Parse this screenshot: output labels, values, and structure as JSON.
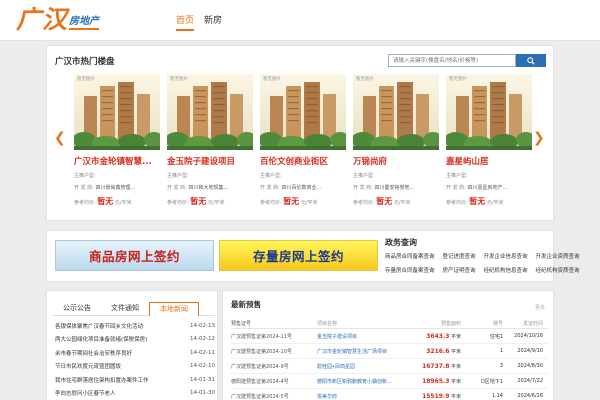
{
  "header": {
    "logo_main": "广汉",
    "logo_sub": "房地产",
    "nav": [
      {
        "label": "首页",
        "active": true
      },
      {
        "label": "新房",
        "active": false
      }
    ]
  },
  "hot": {
    "title": "广汉市热门楼盘",
    "search_placeholder": "请输入关键字(楼盘名/地名/价格等)",
    "prev_arrow": "❮",
    "next_arrow": "❯",
    "cards": [
      {
        "tag": "暂无图片",
        "name": "广汉市金轮镇智慧...",
        "type_label": "主推户型:",
        "type_value": "",
        "dev_label": "开 发 商:",
        "dev_value": "四川景尚鑫管理...",
        "price_label": "参考均价:",
        "price": "暂无",
        "price_unit": "元/平米"
      },
      {
        "tag": "暂无图片",
        "name": "金玉院子建设项目",
        "type_label": "主推户型:",
        "type_value": "",
        "dev_label": "开 发 商:",
        "dev_value": "四川和大地现集...",
        "price_label": "参考均价:",
        "price": "暂无",
        "price_unit": "元/平米"
      },
      {
        "tag": "暂无图片",
        "name": "百伦文创商业街区",
        "type_label": "主推户型:",
        "type_value": "",
        "dev_label": "开 发 商:",
        "dev_value": "四川百伦数商业...",
        "price_label": "参考均价:",
        "price": "暂无",
        "price_unit": "元/平米"
      },
      {
        "tag": "暂无图片",
        "name": "万锦尚府",
        "type_label": "主推户型:",
        "type_value": "",
        "dev_label": "开 发 商:",
        "dev_value": "四川蜀安裕誉地...",
        "price_label": "参考均价:",
        "price": "暂无",
        "price_unit": "元/平米"
      },
      {
        "tag": "暂无图片",
        "name": "嘉星屿山居",
        "type_label": "主推户型:",
        "type_value": "",
        "dev_label": "开 发 商:",
        "dev_value": "四川嘉星房地产...",
        "price_label": "参考均价:",
        "price": "暂无",
        "price_unit": "元/平米"
      }
    ]
  },
  "gov": {
    "banner1": "商品房网上签约",
    "banner2": "存量房网上签约",
    "title": "政务查询",
    "links": [
      "商品房合同备案查询",
      "登记进度查询",
      "开发企业信息查询",
      "开发企业资质查询",
      "存量房合同备案查询",
      "房产证明查询",
      "经纪机构信息查询",
      "经纪机构资质查询"
    ]
  },
  "notices": {
    "tabs": [
      {
        "label": "公示公告",
        "active": false
      },
      {
        "label": "文件通知",
        "active": false
      },
      {
        "label": "本地新闻",
        "active": true
      }
    ],
    "items": [
      {
        "title": "各银保体聚焦广汉春节回乡文化活动",
        "date": "14-02-13"
      },
      {
        "title": "两大公园绿化项目准备就绪(保税保房)",
        "date": "14-02-12"
      },
      {
        "title": "余市春节期间社会治安秩序良好",
        "date": "14-02-11"
      },
      {
        "title": "节日市民欢度元宵暨团圆饭",
        "date": "14-02-10"
      },
      {
        "title": "我市住宅群落居住架构扣置办案件工作",
        "date": "14-01-31"
      },
      {
        "title": "李向志慰问小区春节老人",
        "date": "14-01-30"
      }
    ]
  },
  "presale": {
    "title": "最新预售",
    "more": "更多",
    "headers": [
      "预售证号",
      "项目名称",
      "预售面积",
      "楼号",
      "发证时间"
    ],
    "rows": [
      {
        "cert": "广汉建预售证第2024-11号",
        "project": "金玉院子建设项目",
        "area": "3643.3",
        "unit": "平米",
        "building": "住宅1",
        "date": "2024/10/16"
      },
      {
        "cert": "广汉建预售证第2024-10号",
        "project": "广汉市金轮镇智慧生活广场项目",
        "area": "3216.6",
        "unit": "平米",
        "building": "1",
        "date": "2024/9/10"
      },
      {
        "cert": "广汉建预售证第2024-9号",
        "project": "碧桂园•凤鸣星园",
        "area": "16737.8",
        "unit": "平米",
        "building": "3",
        "date": "2024/8/30"
      },
      {
        "cert": "德阳建预售证第2024-4号",
        "project": "德阳市新区新鸦鹏教育小镇创新...",
        "area": "18965.3",
        "unit": "平米",
        "building": "D区地下1",
        "date": "2024/7/22"
      },
      {
        "cert": "广汉建预售证第2024-5号",
        "project": "悦美华府",
        "area": "15519.9",
        "unit": "平米",
        "building": "1.14",
        "date": "2024/6/26"
      }
    ]
  }
}
